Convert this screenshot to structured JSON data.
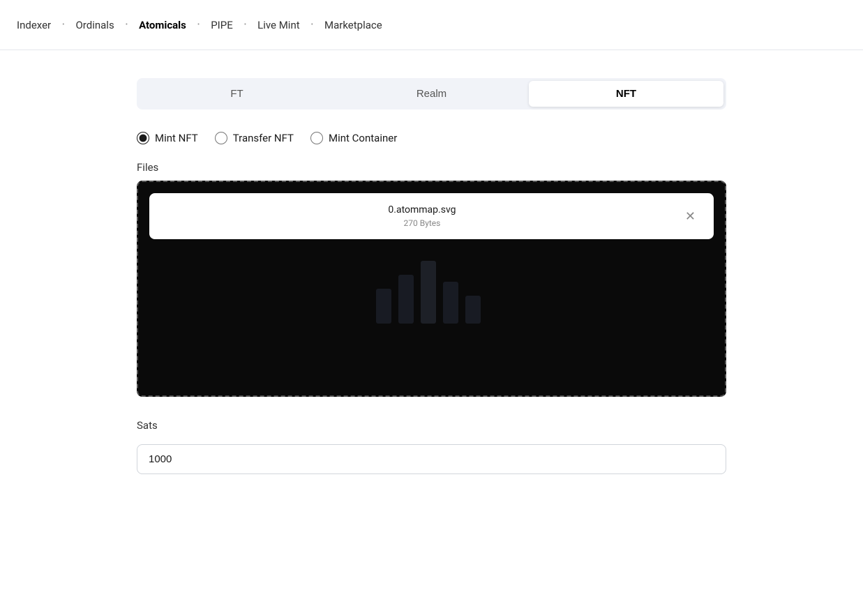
{
  "nav": {
    "items": [
      {
        "label": "Indexer",
        "active": false
      },
      {
        "label": "Ordinals",
        "active": false
      },
      {
        "label": "Atomicals",
        "active": true
      },
      {
        "label": "PIPE",
        "active": false
      },
      {
        "label": "Live Mint",
        "active": false
      },
      {
        "label": "Marketplace",
        "active": false
      }
    ]
  },
  "tabs": [
    {
      "label": "FT",
      "active": false
    },
    {
      "label": "Realm",
      "active": false
    },
    {
      "label": "NFT",
      "active": true
    }
  ],
  "radio_options": [
    {
      "label": "Mint NFT",
      "value": "mint_nft",
      "checked": true
    },
    {
      "label": "Transfer NFT",
      "value": "transfer_nft",
      "checked": false
    },
    {
      "label": "Mint Container",
      "value": "mint_container",
      "checked": false
    }
  ],
  "files_label": "Files",
  "file": {
    "name": "0.atommap.svg",
    "size": "270 Bytes"
  },
  "sats_label": "Sats",
  "sats_value": "1000"
}
